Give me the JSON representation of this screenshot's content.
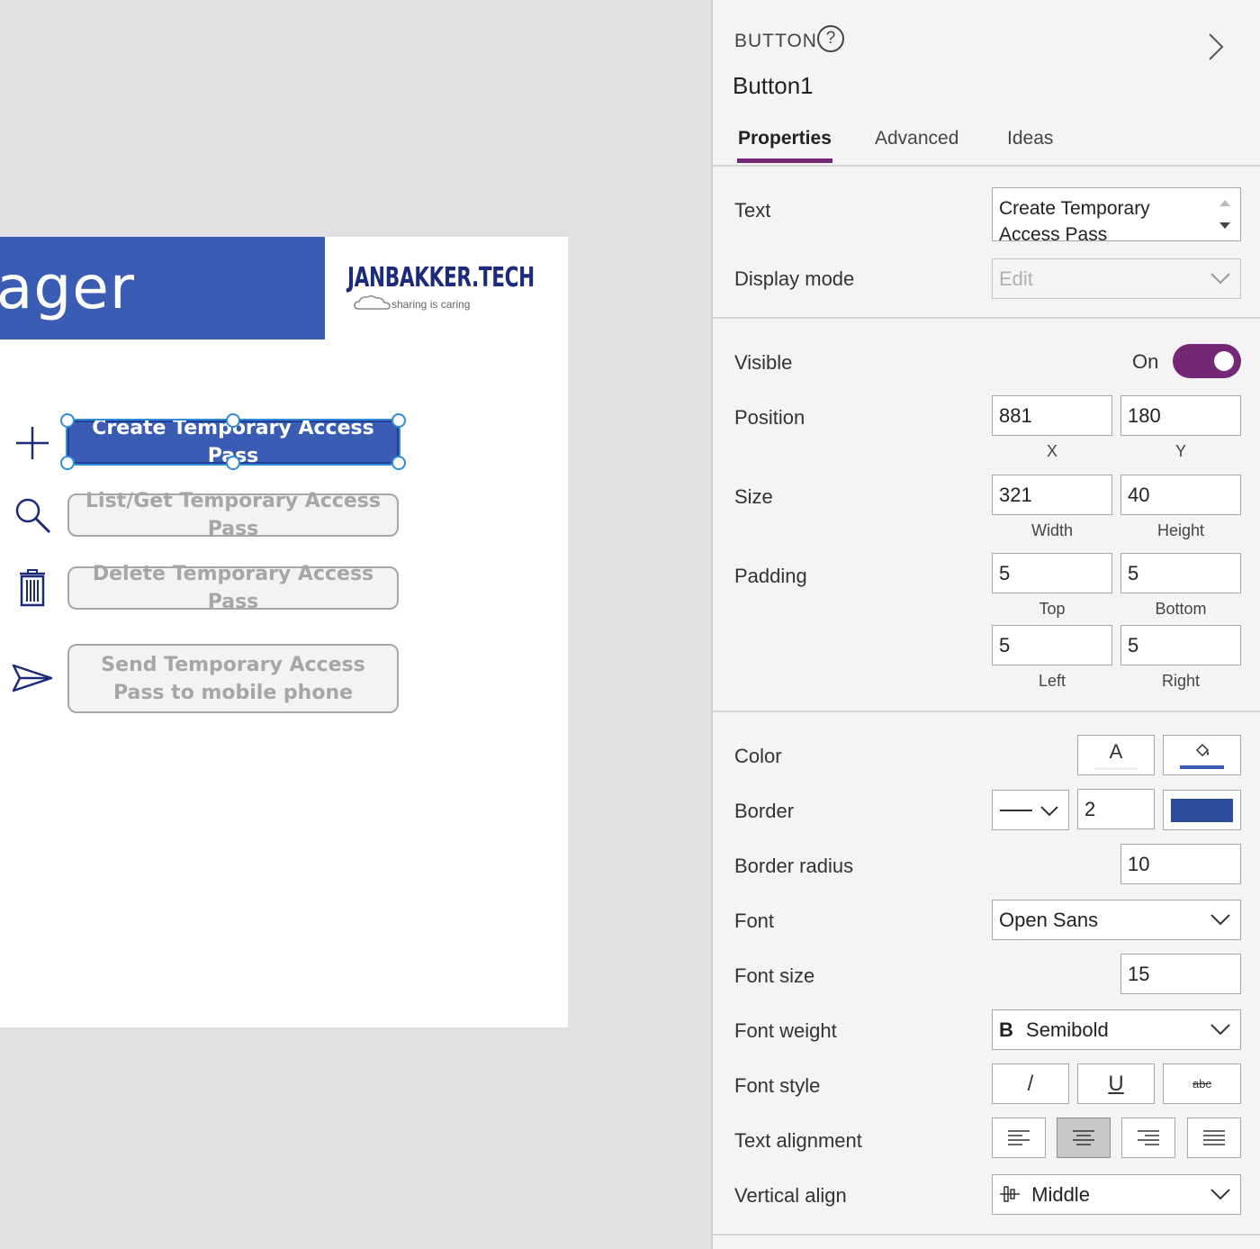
{
  "canvas": {
    "header_title": "ager",
    "logo_text": "JANBAKKER.TECH",
    "logo_tagline": "sharing is caring",
    "buttons": [
      {
        "label": "Create Temporary Access Pass",
        "icon": "plus-icon"
      },
      {
        "label": "List/Get Temporary Access Pass",
        "icon": "search-icon"
      },
      {
        "label": "Delete Temporary Access Pass",
        "icon": "trash-icon"
      },
      {
        "label": "Send Temporary Access Pass to mobile phone",
        "icon": "send-icon"
      }
    ]
  },
  "panel": {
    "control_type": "BUTTON",
    "control_name": "Button1",
    "tabs": {
      "properties": "Properties",
      "advanced": "Advanced",
      "ideas": "Ideas"
    },
    "text": {
      "label": "Text",
      "value": "Create Temporary Access Pass"
    },
    "display_mode": {
      "label": "Display mode",
      "value": "Edit"
    },
    "visible": {
      "label": "Visible",
      "state": "On"
    },
    "position": {
      "label": "Position",
      "x": "881",
      "y": "180",
      "x_label": "X",
      "y_label": "Y"
    },
    "size": {
      "label": "Size",
      "width": "321",
      "height": "40",
      "width_label": "Width",
      "height_label": "Height"
    },
    "padding": {
      "label": "Padding",
      "top": "5",
      "bottom": "5",
      "left": "5",
      "right": "5",
      "top_label": "Top",
      "bottom_label": "Bottom",
      "left_label": "Left",
      "right_label": "Right"
    },
    "color": {
      "label": "Color",
      "text_button": "A",
      "fill_color": "#3a5db3"
    },
    "border": {
      "label": "Border",
      "width": "2",
      "color": "#2c4b9b"
    },
    "border_radius": {
      "label": "Border radius",
      "value": "10"
    },
    "font": {
      "label": "Font",
      "value": "Open Sans"
    },
    "font_size": {
      "label": "Font size",
      "value": "15"
    },
    "font_weight": {
      "label": "Font weight",
      "icon_text": "B",
      "value": "Semibold"
    },
    "font_style": {
      "label": "Font style",
      "italic": "/",
      "underline": "U",
      "strike": "abc"
    },
    "text_alignment": {
      "label": "Text alignment",
      "selected": "center"
    },
    "vertical_align": {
      "label": "Vertical align",
      "value": "Middle"
    }
  },
  "colors": {
    "accent": "#742774",
    "brand_blue": "#3a5db3"
  }
}
